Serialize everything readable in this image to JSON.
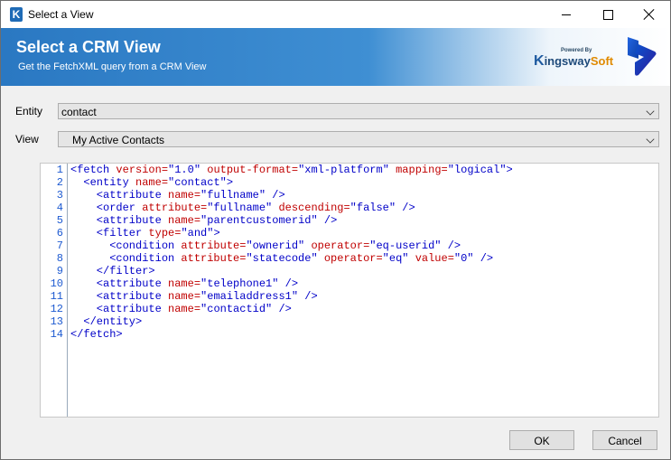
{
  "window": {
    "title": "Select a View"
  },
  "banner": {
    "title": "Select a CRM View",
    "subtitle": "Get the FetchXML query from a CRM View",
    "logo_powered": "Powered By",
    "logo_k": "K",
    "logo_ingsway": "ingsway",
    "logo_soft": "Soft"
  },
  "form": {
    "entity_label": "Entity",
    "entity_value": "contact",
    "view_label": "View",
    "view_value": "My Active Contacts"
  },
  "editor": {
    "line_numbers": [
      "1",
      "2",
      "3",
      "4",
      "5",
      "6",
      "7",
      "8",
      "9",
      "10",
      "11",
      "12",
      "13",
      "14"
    ],
    "lines": [
      [
        [
          "t",
          "<fetch "
        ],
        [
          "a",
          "version="
        ],
        [
          "v",
          "\"1.0\" "
        ],
        [
          "a",
          "output-format="
        ],
        [
          "v",
          "\"xml-platform\" "
        ],
        [
          "a",
          "mapping="
        ],
        [
          "v",
          "\"logical\">"
        ]
      ],
      [
        [
          "t",
          "  <entity "
        ],
        [
          "a",
          "name="
        ],
        [
          "v",
          "\"contact\">"
        ]
      ],
      [
        [
          "t",
          "    <attribute "
        ],
        [
          "a",
          "name="
        ],
        [
          "v",
          "\"fullname\" />"
        ]
      ],
      [
        [
          "t",
          "    <order "
        ],
        [
          "a",
          "attribute="
        ],
        [
          "v",
          "\"fullname\" "
        ],
        [
          "a",
          "descending="
        ],
        [
          "v",
          "\"false\" />"
        ]
      ],
      [
        [
          "t",
          "    <attribute "
        ],
        [
          "a",
          "name="
        ],
        [
          "v",
          "\"parentcustomerid\" />"
        ]
      ],
      [
        [
          "t",
          "    <filter "
        ],
        [
          "a",
          "type="
        ],
        [
          "v",
          "\"and\">"
        ]
      ],
      [
        [
          "t",
          "      <condition "
        ],
        [
          "a",
          "attribute="
        ],
        [
          "v",
          "\"ownerid\" "
        ],
        [
          "a",
          "operator="
        ],
        [
          "v",
          "\"eq-userid\" />"
        ]
      ],
      [
        [
          "t",
          "      <condition "
        ],
        [
          "a",
          "attribute="
        ],
        [
          "v",
          "\"statecode\" "
        ],
        [
          "a",
          "operator="
        ],
        [
          "v",
          "\"eq\" "
        ],
        [
          "a",
          "value="
        ],
        [
          "v",
          "\"0\" />"
        ]
      ],
      [
        [
          "t",
          "    </filter>"
        ]
      ],
      [
        [
          "t",
          "    <attribute "
        ],
        [
          "a",
          "name="
        ],
        [
          "v",
          "\"telephone1\" />"
        ]
      ],
      [
        [
          "t",
          "    <attribute "
        ],
        [
          "a",
          "name="
        ],
        [
          "v",
          "\"emailaddress1\" />"
        ]
      ],
      [
        [
          "t",
          "    <attribute "
        ],
        [
          "a",
          "name="
        ],
        [
          "v",
          "\"contactid\" />"
        ]
      ],
      [
        [
          "t",
          "  </entity>"
        ]
      ],
      [
        [
          "t",
          "</fetch>"
        ]
      ]
    ]
  },
  "buttons": {
    "ok": "OK",
    "cancel": "Cancel"
  }
}
